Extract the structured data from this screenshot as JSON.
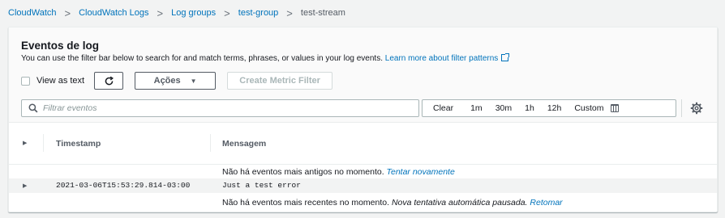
{
  "breadcrumb": {
    "items": [
      "CloudWatch",
      "CloudWatch Logs",
      "Log groups",
      "test-group"
    ],
    "current": "test-stream",
    "separator": ">"
  },
  "panel": {
    "title": "Eventos de log",
    "description": "You can use the filter bar below to search for and match terms, phrases, or values in your log events.",
    "learn_more_link": "Learn more about filter patterns"
  },
  "toolbar": {
    "view_as_text_label": "View as text",
    "view_as_text_checked": false,
    "refresh_icon": "refresh-icon",
    "actions_label": "Ações",
    "create_metric_filter_label": "Create Metric Filter"
  },
  "search": {
    "placeholder": "Filtrar eventos",
    "value": ""
  },
  "time_range": {
    "clear_label": "Clear",
    "options": [
      "1m",
      "30m",
      "1h",
      "12h"
    ],
    "custom_label": "Custom"
  },
  "table": {
    "columns": [
      "Timestamp",
      "Mensagem"
    ],
    "older_notice": "Não há eventos mais antigos no momento.",
    "older_retry": "Tentar novamente",
    "events": [
      {
        "timestamp": "2021-03-06T15:53:29.814-03:00",
        "message": "Just a test error"
      }
    ],
    "newer_notice": "Não há eventos mais recentes no momento.",
    "newer_status": "Nova tentativa automática pausada.",
    "newer_retry": "Retomar"
  },
  "colors": {
    "link": "#0073bb",
    "background": "#f2f3f3",
    "panel_header": "#fafafa"
  }
}
